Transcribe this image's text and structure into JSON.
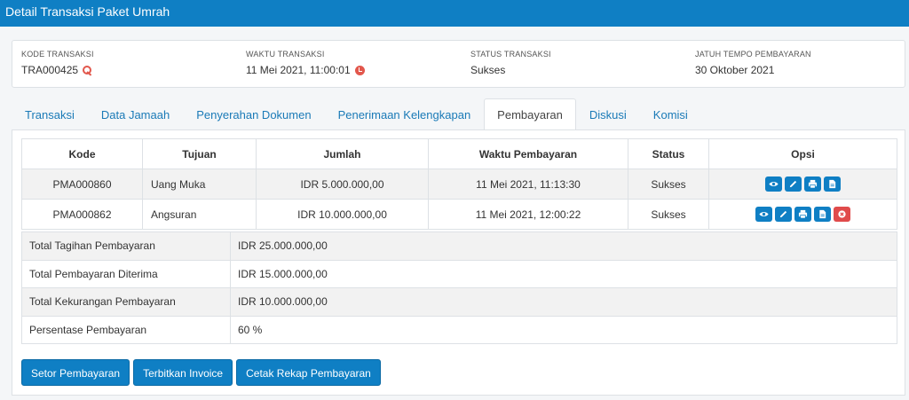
{
  "header": {
    "title": "Detail Transaksi Paket Umrah"
  },
  "info": [
    {
      "label": "KODE TRANSAKSI",
      "value": "TRA000425",
      "icon": "key-icon"
    },
    {
      "label": "WAKTU TRANSAKSI",
      "value": "11 Mei 2021, 11:00:01",
      "icon": "clock-icon"
    },
    {
      "label": "STATUS TRANSAKSI",
      "value": "Sukses"
    },
    {
      "label": "JATUH TEMPO PEMBAYARAN",
      "value": "30 Oktober 2021"
    }
  ],
  "tabs": [
    {
      "label": "Transaksi"
    },
    {
      "label": "Data Jamaah"
    },
    {
      "label": "Penyerahan Dokumen"
    },
    {
      "label": "Penerimaan Kelengkapan"
    },
    {
      "label": "Pembayaran",
      "active": true
    },
    {
      "label": "Diskusi"
    },
    {
      "label": "Komisi"
    }
  ],
  "payments": {
    "columns": [
      "Kode",
      "Tujuan",
      "Jumlah",
      "Waktu Pembayaran",
      "Status",
      "Opsi"
    ],
    "rows": [
      {
        "kode": "PMA000860",
        "tujuan": "Uang Muka",
        "jumlah": "IDR 5.000.000,00",
        "waktu": "11 Mei 2021, 11:13:30",
        "status": "Sukses",
        "actions": [
          "eye-icon",
          "pencil-icon",
          "print-icon",
          "file-icon"
        ]
      },
      {
        "kode": "PMA000862",
        "tujuan": "Angsuran",
        "jumlah": "IDR 10.000.000,00",
        "waktu": "11 Mei 2021, 12:00:22",
        "status": "Sukses",
        "actions": [
          "eye-icon",
          "pencil-icon",
          "print-icon",
          "file-icon",
          "delete-icon"
        ]
      }
    ]
  },
  "summary": [
    {
      "label": "Total Tagihan Pembayaran",
      "value": "IDR 25.000.000,00"
    },
    {
      "label": "Total Pembayaran Diterima",
      "value": "IDR 15.000.000,00"
    },
    {
      "label": "Total Kekurangan Pembayaran",
      "value": "IDR 10.000.000,00"
    },
    {
      "label": "Persentase Pembayaran",
      "value": "60 %"
    }
  ],
  "buttons": {
    "setor": "Setor Pembayaran",
    "invoice": "Terbitkan Invoice",
    "rekap": "Cetak Rekap Pembayaran"
  },
  "colors": {
    "primary": "#0f7fc4",
    "danger": "#e04b4b",
    "accent_icon": "#e2574c"
  }
}
